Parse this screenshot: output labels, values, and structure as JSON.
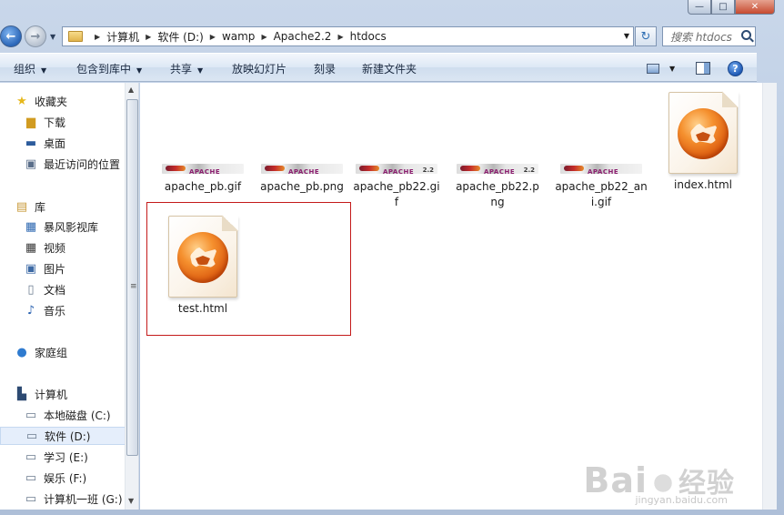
{
  "window": {
    "minimize": "—",
    "maximize": "□",
    "close": "✕"
  },
  "nav": {
    "back": "←",
    "forward": "→",
    "history": "▼"
  },
  "address": {
    "crumbs": [
      "计算机",
      "软件 (D:)",
      "wamp",
      "Apache2.2",
      "htdocs"
    ],
    "sep": "▶",
    "dropdown": "▼",
    "refresh": "↻"
  },
  "search": {
    "placeholder": "搜索 htdocs"
  },
  "toolbar": {
    "organize": "组织",
    "include_library": "包含到库中",
    "share": "共享",
    "slideshow": "放映幻灯片",
    "burn": "刻录",
    "new_folder": "新建文件夹",
    "caret": "▼",
    "help": "?"
  },
  "sidebar": {
    "favorites": {
      "title": "收藏夹",
      "items": [
        "下载",
        "桌面",
        "最近访问的位置"
      ]
    },
    "libraries": {
      "title": "库",
      "items": [
        "暴风影视库",
        "视频",
        "图片",
        "文档",
        "音乐"
      ]
    },
    "homegroup": "家庭组",
    "computer": {
      "title": "计算机",
      "items": [
        "本地磁盘 (C:)",
        "软件 (D:)",
        "学习  (E:)",
        "娱乐 (F:)",
        "计算机一班 (G:)"
      ]
    },
    "scroll_up": "▲",
    "scroll_down": "▼",
    "grip": "≡"
  },
  "files": [
    {
      "name": "apache_pb.gif",
      "kind": "banner"
    },
    {
      "name": "apache_pb.png",
      "kind": "banner"
    },
    {
      "name": "apache_pb22.gif",
      "kind": "banner22"
    },
    {
      "name": "apache_pb22.png",
      "kind": "banner22"
    },
    {
      "name": "apache_pb22_ani.gif",
      "kind": "banner"
    },
    {
      "name": "index.html",
      "kind": "html"
    },
    {
      "name": "test.html",
      "kind": "html"
    }
  ],
  "banner_wordmark": "APACHE",
  "watermark": {
    "brand": "Bai",
    "brand2": "经验",
    "url": "jingyan.baidu.com"
  },
  "colors": {
    "selection_box": "#c41a1a",
    "accent": "#2a66b8"
  }
}
